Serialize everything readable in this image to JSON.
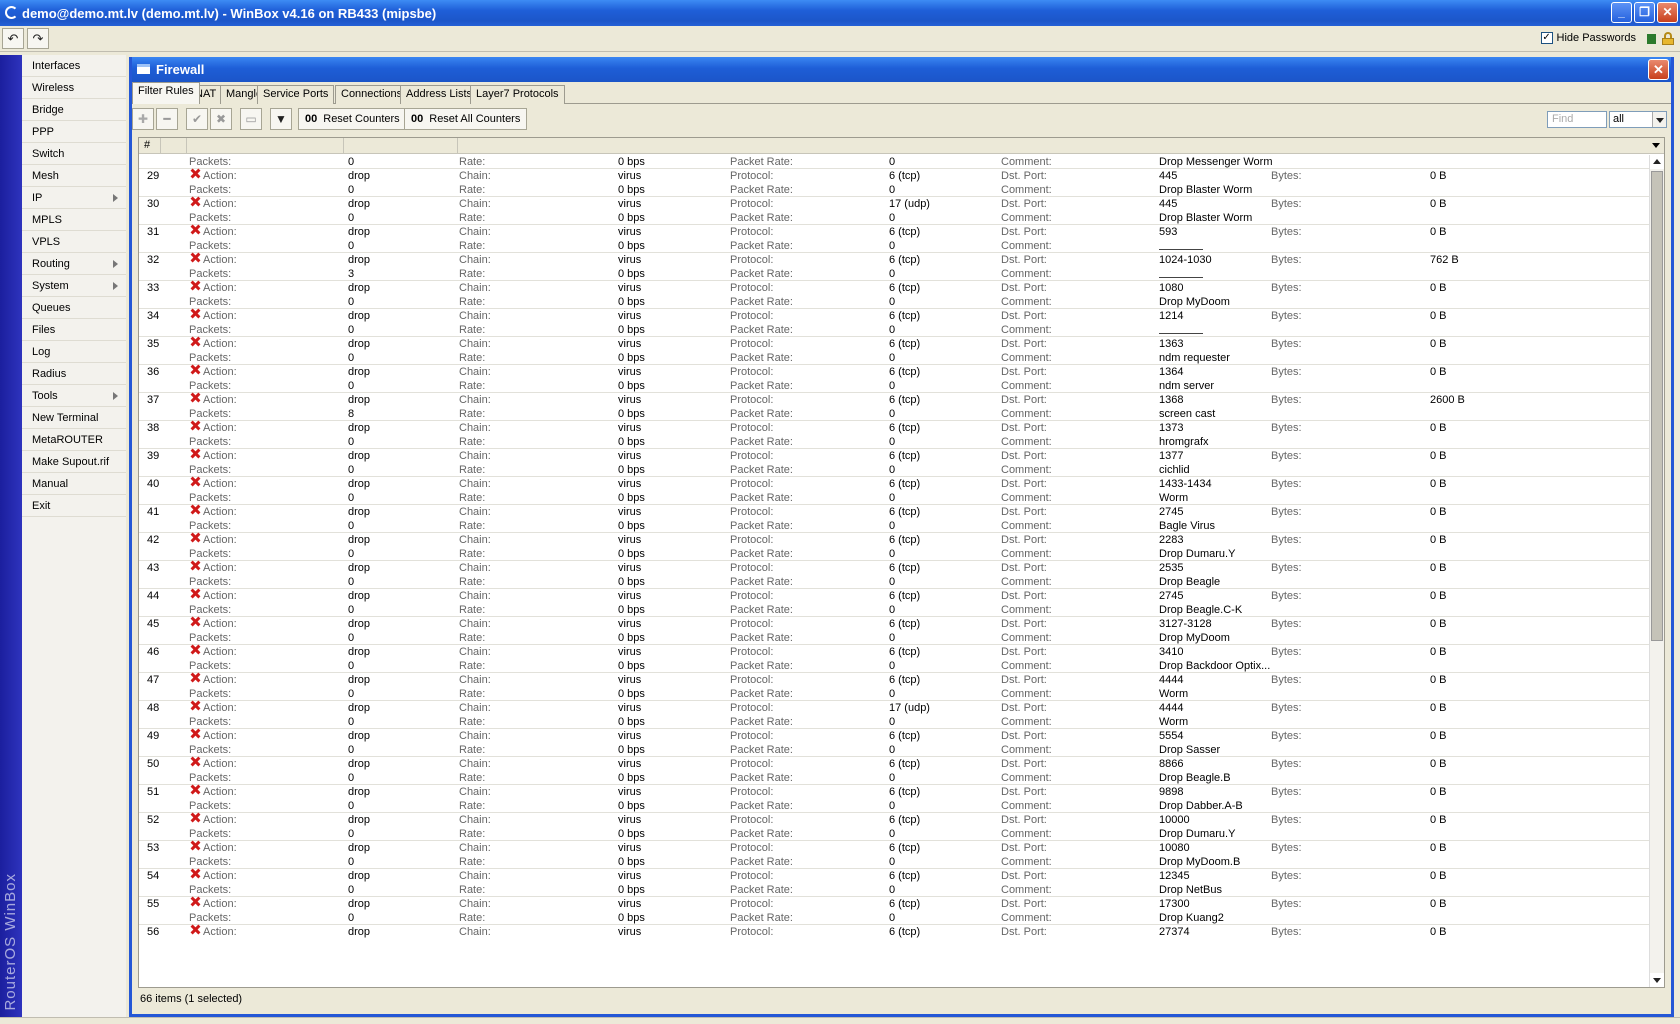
{
  "window": {
    "title": "demo@demo.mt.lv (demo.mt.lv) - WinBox v4.16 on RB433 (mipsbe)",
    "hide_passwords_label": "Hide Passwords",
    "hide_passwords_checked": "✓"
  },
  "sidebar": {
    "brand": "RouterOS WinBox",
    "items": [
      {
        "label": "Interfaces",
        "submenu": false
      },
      {
        "label": "Wireless",
        "submenu": false
      },
      {
        "label": "Bridge",
        "submenu": false
      },
      {
        "label": "PPP",
        "submenu": false
      },
      {
        "label": "Switch",
        "submenu": false
      },
      {
        "label": "Mesh",
        "submenu": false
      },
      {
        "label": "IP",
        "submenu": true
      },
      {
        "label": "MPLS",
        "submenu": false
      },
      {
        "label": "VPLS",
        "submenu": false
      },
      {
        "label": "Routing",
        "submenu": true
      },
      {
        "label": "System",
        "submenu": true
      },
      {
        "label": "Queues",
        "submenu": false
      },
      {
        "label": "Files",
        "submenu": false
      },
      {
        "label": "Log",
        "submenu": false
      },
      {
        "label": "Radius",
        "submenu": false
      },
      {
        "label": "Tools",
        "submenu": true
      },
      {
        "label": "New Terminal",
        "submenu": false
      },
      {
        "label": "MetaROUTER",
        "submenu": false
      },
      {
        "label": "Make Supout.rif",
        "submenu": false
      },
      {
        "label": "Manual",
        "submenu": false
      },
      {
        "label": "Exit",
        "submenu": false
      }
    ]
  },
  "firewall": {
    "title": "Firewall",
    "tabs": [
      "Filter Rules",
      "NAT",
      "Mangle",
      "Service Ports",
      "Connections",
      "Address Lists",
      "Layer7 Protocols"
    ],
    "toolbar": {
      "reset_counters": "Reset Counters",
      "reset_all_counters": "Reset All Counters",
      "counter_glyph": "00",
      "find_placeholder": "Find",
      "filter_value": "all"
    },
    "column_header": "#",
    "labels": {
      "action": "Action:",
      "chain": "Chain:",
      "protocol": "Protocol:",
      "dst_port": "Dst. Port:",
      "bytes": "Bytes:",
      "packets": "Packets:",
      "rate": "Rate:",
      "packet_rate": "Packet Rate:",
      "comment": "Comment:"
    },
    "top_partial": {
      "packets": "0",
      "rate": "0 bps",
      "packet_rate": "0",
      "comment": "Drop Messenger Worm"
    },
    "rules": [
      {
        "num": "29",
        "action": "drop",
        "chain": "virus",
        "protocol": "6 (tcp)",
        "dst_port": "445",
        "bytes": "0 B",
        "packets": "0",
        "rate": "0 bps",
        "packet_rate": "0",
        "comment": "Drop Blaster Worm"
      },
      {
        "num": "30",
        "action": "drop",
        "chain": "virus",
        "protocol": "17 (udp)",
        "dst_port": "445",
        "bytes": "0 B",
        "packets": "0",
        "rate": "0 bps",
        "packet_rate": "0",
        "comment": "Drop Blaster Worm"
      },
      {
        "num": "31",
        "action": "drop",
        "chain": "virus",
        "protocol": "6 (tcp)",
        "dst_port": "593",
        "bytes": "0 B",
        "packets": "0",
        "rate": "0 bps",
        "packet_rate": "0",
        "comment": ""
      },
      {
        "num": "32",
        "action": "drop",
        "chain": "virus",
        "protocol": "6 (tcp)",
        "dst_port": "1024-1030",
        "bytes": "762 B",
        "packets": "3",
        "rate": "0 bps",
        "packet_rate": "0",
        "comment": ""
      },
      {
        "num": "33",
        "action": "drop",
        "chain": "virus",
        "protocol": "6 (tcp)",
        "dst_port": "1080",
        "bytes": "0 B",
        "packets": "0",
        "rate": "0 bps",
        "packet_rate": "0",
        "comment": "Drop MyDoom"
      },
      {
        "num": "34",
        "action": "drop",
        "chain": "virus",
        "protocol": "6 (tcp)",
        "dst_port": "1214",
        "bytes": "0 B",
        "packets": "0",
        "rate": "0 bps",
        "packet_rate": "0",
        "comment": ""
      },
      {
        "num": "35",
        "action": "drop",
        "chain": "virus",
        "protocol": "6 (tcp)",
        "dst_port": "1363",
        "bytes": "0 B",
        "packets": "0",
        "rate": "0 bps",
        "packet_rate": "0",
        "comment": "ndm requester"
      },
      {
        "num": "36",
        "action": "drop",
        "chain": "virus",
        "protocol": "6 (tcp)",
        "dst_port": "1364",
        "bytes": "0 B",
        "packets": "0",
        "rate": "0 bps",
        "packet_rate": "0",
        "comment": "ndm server"
      },
      {
        "num": "37",
        "action": "drop",
        "chain": "virus",
        "protocol": "6 (tcp)",
        "dst_port": "1368",
        "bytes": "2600 B",
        "packets": "8",
        "rate": "0 bps",
        "packet_rate": "0",
        "comment": "screen cast"
      },
      {
        "num": "38",
        "action": "drop",
        "chain": "virus",
        "protocol": "6 (tcp)",
        "dst_port": "1373",
        "bytes": "0 B",
        "packets": "0",
        "rate": "0 bps",
        "packet_rate": "0",
        "comment": "hromgrafx"
      },
      {
        "num": "39",
        "action": "drop",
        "chain": "virus",
        "protocol": "6 (tcp)",
        "dst_port": "1377",
        "bytes": "0 B",
        "packets": "0",
        "rate": "0 bps",
        "packet_rate": "0",
        "comment": "cichlid"
      },
      {
        "num": "40",
        "action": "drop",
        "chain": "virus",
        "protocol": "6 (tcp)",
        "dst_port": "1433-1434",
        "bytes": "0 B",
        "packets": "0",
        "rate": "0 bps",
        "packet_rate": "0",
        "comment": "Worm"
      },
      {
        "num": "41",
        "action": "drop",
        "chain": "virus",
        "protocol": "6 (tcp)",
        "dst_port": "2745",
        "bytes": "0 B",
        "packets": "0",
        "rate": "0 bps",
        "packet_rate": "0",
        "comment": "Bagle Virus"
      },
      {
        "num": "42",
        "action": "drop",
        "chain": "virus",
        "protocol": "6 (tcp)",
        "dst_port": "2283",
        "bytes": "0 B",
        "packets": "0",
        "rate": "0 bps",
        "packet_rate": "0",
        "comment": "Drop Dumaru.Y"
      },
      {
        "num": "43",
        "action": "drop",
        "chain": "virus",
        "protocol": "6 (tcp)",
        "dst_port": "2535",
        "bytes": "0 B",
        "packets": "0",
        "rate": "0 bps",
        "packet_rate": "0",
        "comment": "Drop Beagle"
      },
      {
        "num": "44",
        "action": "drop",
        "chain": "virus",
        "protocol": "6 (tcp)",
        "dst_port": "2745",
        "bytes": "0 B",
        "packets": "0",
        "rate": "0 bps",
        "packet_rate": "0",
        "comment": "Drop Beagle.C-K"
      },
      {
        "num": "45",
        "action": "drop",
        "chain": "virus",
        "protocol": "6 (tcp)",
        "dst_port": "3127-3128",
        "bytes": "0 B",
        "packets": "0",
        "rate": "0 bps",
        "packet_rate": "0",
        "comment": "Drop MyDoom"
      },
      {
        "num": "46",
        "action": "drop",
        "chain": "virus",
        "protocol": "6 (tcp)",
        "dst_port": "3410",
        "bytes": "0 B",
        "packets": "0",
        "rate": "0 bps",
        "packet_rate": "0",
        "comment": "Drop Backdoor Optix..."
      },
      {
        "num": "47",
        "action": "drop",
        "chain": "virus",
        "protocol": "6 (tcp)",
        "dst_port": "4444",
        "bytes": "0 B",
        "packets": "0",
        "rate": "0 bps",
        "packet_rate": "0",
        "comment": "Worm"
      },
      {
        "num": "48",
        "action": "drop",
        "chain": "virus",
        "protocol": "17 (udp)",
        "dst_port": "4444",
        "bytes": "0 B",
        "packets": "0",
        "rate": "0 bps",
        "packet_rate": "0",
        "comment": "Worm"
      },
      {
        "num": "49",
        "action": "drop",
        "chain": "virus",
        "protocol": "6 (tcp)",
        "dst_port": "5554",
        "bytes": "0 B",
        "packets": "0",
        "rate": "0 bps",
        "packet_rate": "0",
        "comment": "Drop Sasser"
      },
      {
        "num": "50",
        "action": "drop",
        "chain": "virus",
        "protocol": "6 (tcp)",
        "dst_port": "8866",
        "bytes": "0 B",
        "packets": "0",
        "rate": "0 bps",
        "packet_rate": "0",
        "comment": "Drop Beagle.B"
      },
      {
        "num": "51",
        "action": "drop",
        "chain": "virus",
        "protocol": "6 (tcp)",
        "dst_port": "9898",
        "bytes": "0 B",
        "packets": "0",
        "rate": "0 bps",
        "packet_rate": "0",
        "comment": "Drop Dabber.A-B"
      },
      {
        "num": "52",
        "action": "drop",
        "chain": "virus",
        "protocol": "6 (tcp)",
        "dst_port": "10000",
        "bytes": "0 B",
        "packets": "0",
        "rate": "0 bps",
        "packet_rate": "0",
        "comment": "Drop Dumaru.Y"
      },
      {
        "num": "53",
        "action": "drop",
        "chain": "virus",
        "protocol": "6 (tcp)",
        "dst_port": "10080",
        "bytes": "0 B",
        "packets": "0",
        "rate": "0 bps",
        "packet_rate": "0",
        "comment": "Drop MyDoom.B"
      },
      {
        "num": "54",
        "action": "drop",
        "chain": "virus",
        "protocol": "6 (tcp)",
        "dst_port": "12345",
        "bytes": "0 B",
        "packets": "0",
        "rate": "0 bps",
        "packet_rate": "0",
        "comment": "Drop NetBus"
      },
      {
        "num": "55",
        "action": "drop",
        "chain": "virus",
        "protocol": "6 (tcp)",
        "dst_port": "17300",
        "bytes": "0 B",
        "packets": "0",
        "rate": "0 bps",
        "packet_rate": "0",
        "comment": "Drop Kuang2"
      },
      {
        "num": "56",
        "action": "drop",
        "chain": "virus",
        "protocol": "6 (tcp)",
        "dst_port": "27374",
        "bytes": "0 B",
        "packets": "",
        "rate": "",
        "packet_rate": "",
        "comment": ""
      }
    ],
    "status": "66 items (1 selected)"
  }
}
